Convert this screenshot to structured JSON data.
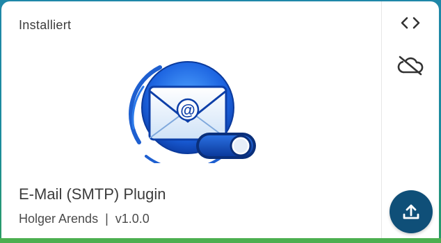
{
  "card": {
    "status_label": "Installiert",
    "plugin_name": "E-Mail (SMTP) Plugin",
    "author": "Holger Arends",
    "separator": "|",
    "version": "v1.0.0"
  },
  "actions": {
    "code_icon": "code-icon",
    "cloud_icon": "cloud-off-icon",
    "upload_icon": "upload-icon"
  },
  "colors": {
    "accent": "#0f4f78",
    "status_bar": "#4caf50",
    "frame": "#1f87a8"
  }
}
